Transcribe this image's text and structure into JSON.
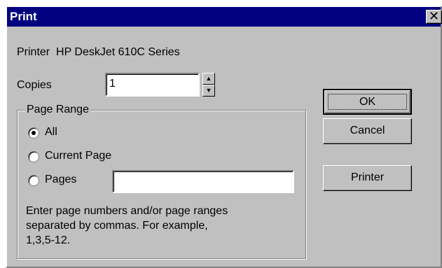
{
  "window": {
    "title": "Print",
    "close_glyph": "✕",
    "titlebar_color": "#000080",
    "face_color": "#c0c0c0"
  },
  "printer": {
    "label": "Printer",
    "name": "HP DeskJet 610C Series"
  },
  "copies": {
    "label": "Copies",
    "value": "1",
    "spin_up_icon": "▲",
    "spin_down_icon": "▼"
  },
  "page_range": {
    "legend": "Page Range",
    "options": [
      {
        "label": "All",
        "selected": true
      },
      {
        "label": "Current Page",
        "selected": false
      },
      {
        "label": "Pages",
        "selected": false
      }
    ],
    "pages_value": "",
    "help_text": "Enter page numbers and/or page ranges separated by commas.  For example, 1,3,5-12."
  },
  "buttons": {
    "ok": "OK",
    "cancel": "Cancel",
    "printer": "Printer"
  }
}
